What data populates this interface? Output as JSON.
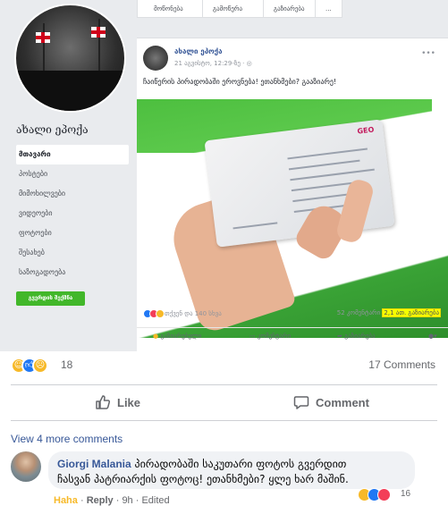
{
  "embedded_page": {
    "page_name": "ახალი ეპოქა",
    "nav_items": [
      "მთავარი",
      "პოსტები",
      "მიმოხილვები",
      "ვიდეოები",
      "ფოტოები",
      "შესახებ",
      "საზოგადოება"
    ],
    "create_page_label": "გვერდის შექმნა",
    "top_actions": [
      "მოწონება",
      "გამოწერა",
      "გაზიარება",
      "..."
    ]
  },
  "embedded_post": {
    "author": "ახალი ეპოქა",
    "meta": "21 აგვისტო, 12:29-ზე · ",
    "text": "ჩაიწერის პირადობაში ეროვნება! ეთანხმები? გააზიარე!",
    "image_card_label": "GEO",
    "stats_reactions": "თქვენ და 140 სხვა",
    "stats_comments": "52 კომენტარი",
    "stats_shares": "2,1 ათ. გაზიარება",
    "actions": [
      "გაზიარებული",
      "კომენტარი",
      "გაზიარება"
    ]
  },
  "reactions": {
    "count": "18",
    "icons": [
      "haha-icon",
      "like-icon",
      "sad-icon"
    ]
  },
  "comments_count": "17 Comments",
  "actions": {
    "like": "Like",
    "comment": "Comment"
  },
  "view_more": "View 4 more comments",
  "comment": {
    "author": "Giorgi Malania",
    "text_line1": " პირადობაში საკუთარი ფოტოს გვერდით",
    "text_line2": "ჩასვან პატრიარქის ფოტოც! ეთანხმები? ყლე ხარ მაშინ.",
    "reaction_count": "16",
    "action_haha": "Haha",
    "action_reply": "Reply",
    "time": "9h",
    "edited": "Edited"
  },
  "colors": {
    "fb_blue": "#385898",
    "like_blue": "#2078f4",
    "haha_yellow": "#f7b928",
    "green": "#42b72a",
    "highlight": "#f7ff00"
  }
}
